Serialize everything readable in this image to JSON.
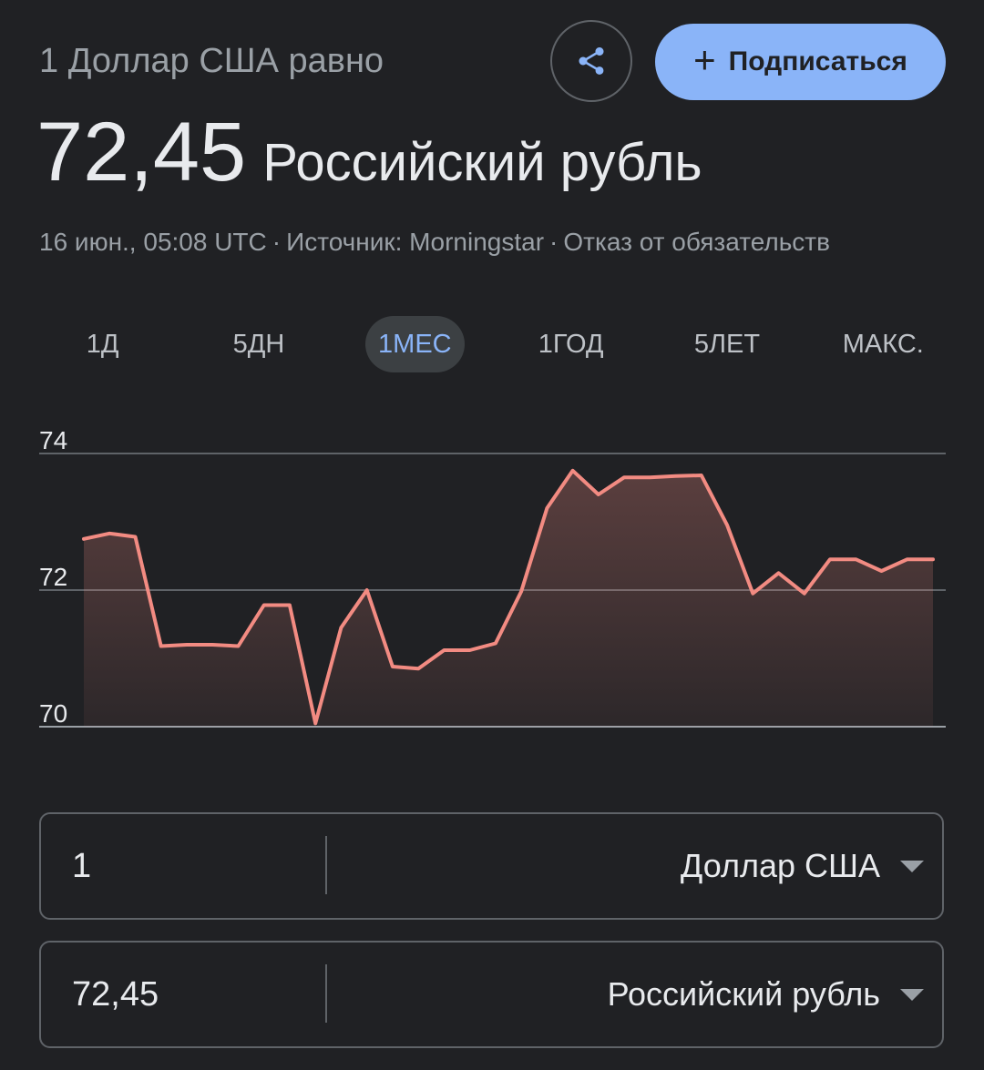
{
  "header": {
    "subtitle": "1 Доллар США равно",
    "rate_value": "72,45",
    "rate_currency": "Российский рубль",
    "share_icon": "share-icon",
    "subscribe_label": "Подписаться"
  },
  "meta": {
    "timestamp": "16 июн., 05:08 UTC",
    "source": "Источник: Morningstar",
    "disclaimer": "Отказ от обязательств"
  },
  "tabs": [
    {
      "label": "1Д",
      "active": false
    },
    {
      "label": "5ДН",
      "active": false
    },
    {
      "label": "1МЕС",
      "active": true
    },
    {
      "label": "1ГОД",
      "active": false
    },
    {
      "label": "5ЛЕТ",
      "active": false
    },
    {
      "label": "МАКС.",
      "active": false
    }
  ],
  "chart_data": {
    "type": "area",
    "ylim": [
      70,
      74
    ],
    "yticks": [
      "74",
      "72",
      "70"
    ],
    "ytick_values": [
      74,
      72,
      70
    ],
    "grid": true,
    "line_color": "#f28b82",
    "values": [
      72.75,
      72.83,
      72.78,
      71.18,
      71.2,
      71.2,
      71.18,
      71.78,
      71.78,
      70.05,
      71.45,
      72.0,
      70.88,
      70.85,
      71.12,
      71.12,
      71.22,
      71.98,
      73.2,
      73.75,
      73.4,
      73.65,
      73.65,
      73.67,
      73.68,
      72.95,
      71.95,
      72.25,
      71.95,
      72.45,
      72.45,
      72.28,
      72.45,
      72.45
    ]
  },
  "converter": {
    "from": {
      "amount": "1",
      "currency": "Доллар США"
    },
    "to": {
      "amount": "72,45",
      "currency": "Российский рубль"
    }
  },
  "colors": {
    "background": "#202124",
    "accent": "#8ab4f8",
    "series": "#f28b82"
  }
}
